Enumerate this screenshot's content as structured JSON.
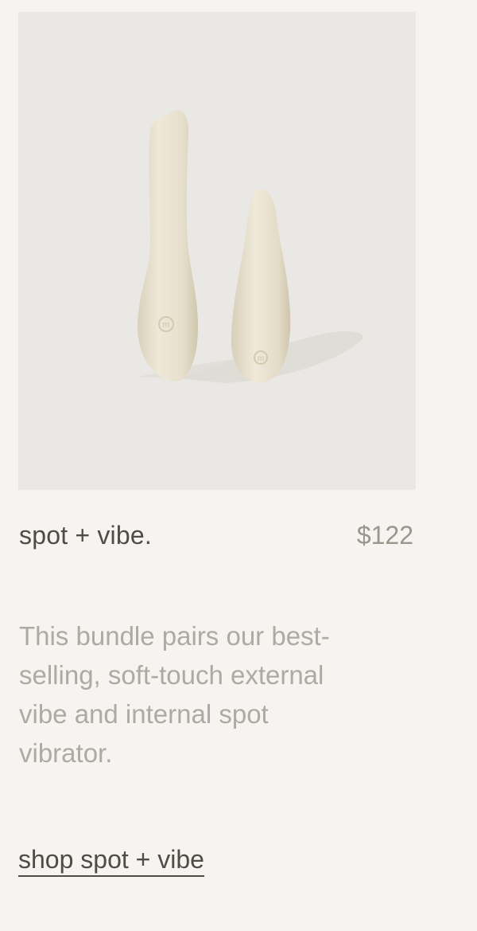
{
  "product": {
    "title": "spot + vibe.",
    "price": "$122",
    "description": "This bundle pairs our best-selling, soft-touch external vibe and internal spot vibrator.",
    "cta_label": "shop spot + vibe"
  },
  "colors": {
    "page_background": "#f5f4f1",
    "image_background": "#e9e8e4",
    "product_color": "#e7e0cd",
    "title_text": "#4f4b45",
    "price_text": "#9a968d",
    "description_text": "#aeaaa1"
  }
}
